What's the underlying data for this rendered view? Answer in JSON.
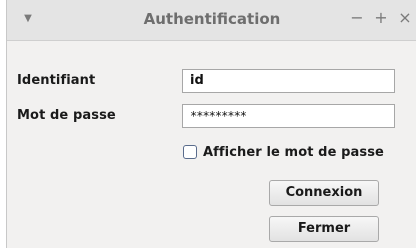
{
  "window": {
    "title": "Authentification",
    "menu_icon": "triangle-down-icon",
    "controls": {
      "minimize": "−",
      "maximize": "+",
      "close": "×"
    }
  },
  "form": {
    "username_label": "Identifiant",
    "username_value": "id",
    "password_label": "Mot de passe",
    "password_value": "*********",
    "show_password_label": "Afficher le mot de passe",
    "show_password_checked": false
  },
  "buttons": {
    "connect_label": "Connexion",
    "close_label": "Fermer"
  }
}
